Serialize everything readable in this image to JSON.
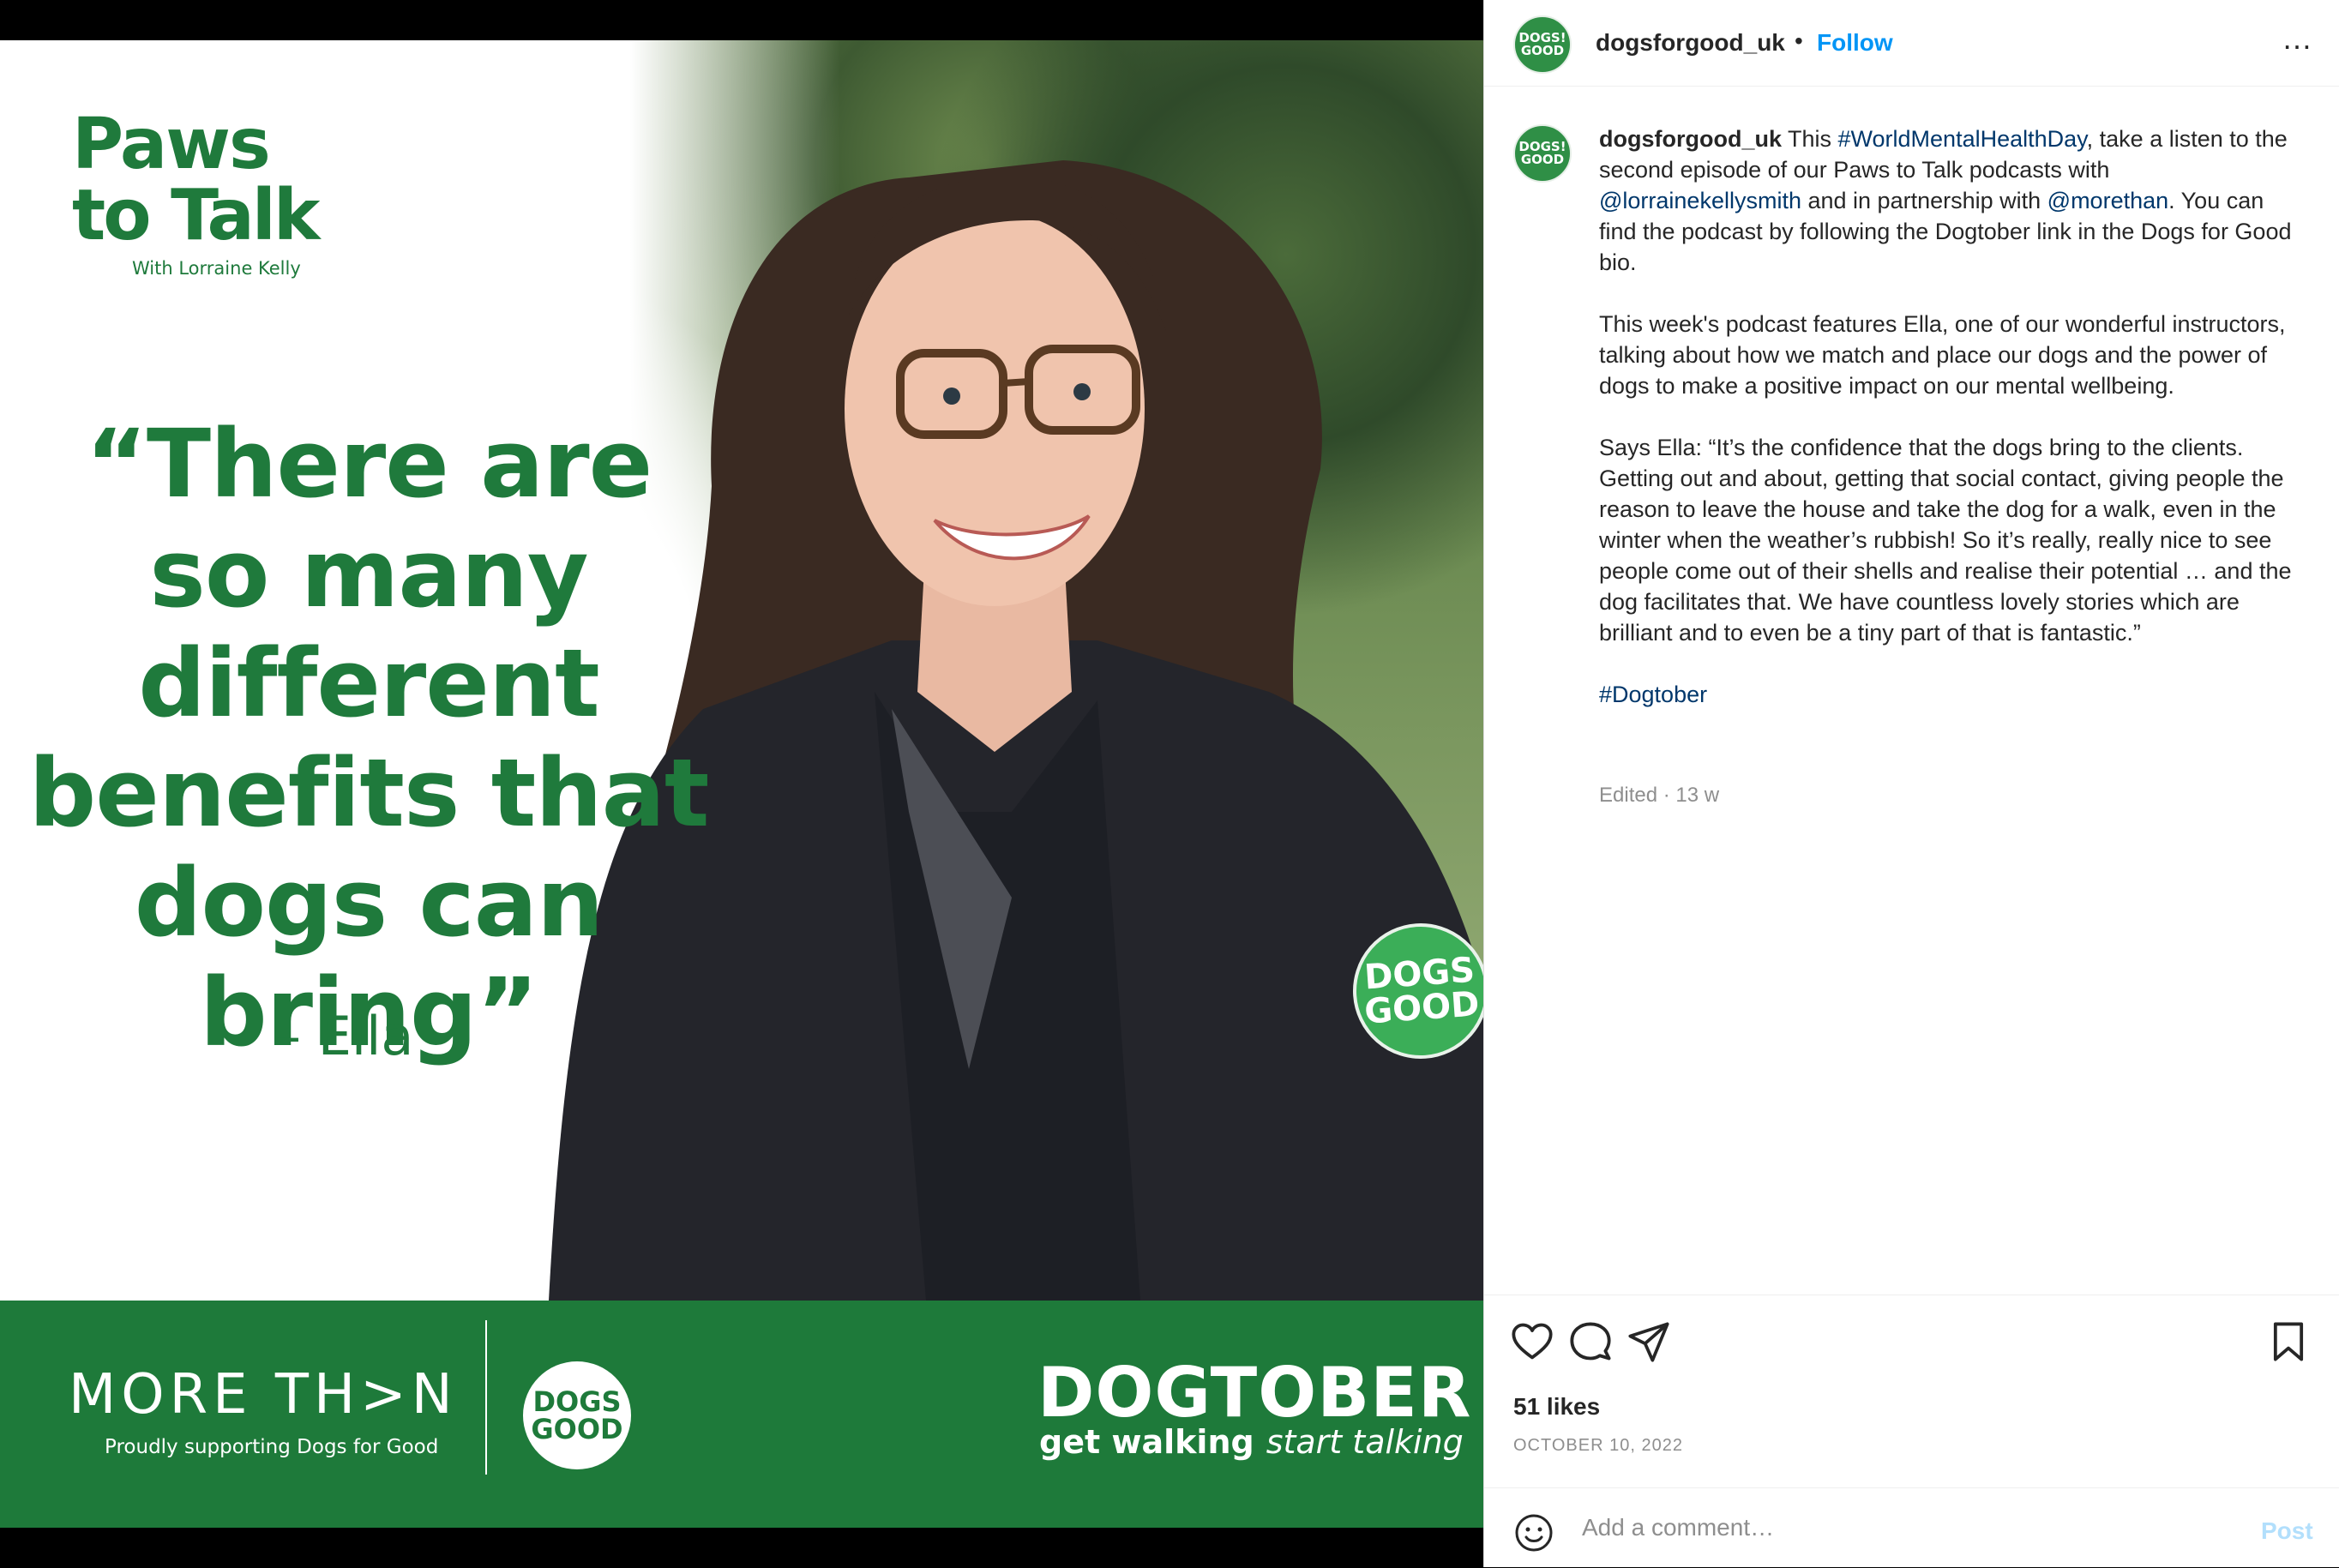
{
  "media": {
    "paws_logo": {
      "line1": "Paws",
      "line2": "to Talk",
      "line3": "With Lorraine Kelly"
    },
    "quote": "“There are so many different benefits that dogs can bring”",
    "quote_author": "– Ella",
    "badge": {
      "line1": "DOGS",
      "line2": "GOOD"
    },
    "banner": {
      "morethan": "MORE TH>N",
      "morethan_sub": "Proudly supporting Dogs for Good",
      "logo_line1": "DOGS",
      "logo_line2": "GOOD",
      "dogtober": "DOGTOBER",
      "dogtober_sub1": "get walking",
      "dogtober_sub2": "start talking"
    }
  },
  "header": {
    "avatar": {
      "line1": "DOGS!",
      "line2": "GOOD"
    },
    "username": "dogsforgood_uk",
    "dot": "•",
    "follow_label": "Follow",
    "more_label": "…"
  },
  "caption": {
    "username": "dogsforgood_uk",
    "p1_a": " This ",
    "p1_tag": "#WorldMentalHealthDay",
    "p1_b": ", take a listen to the second episode of our Paws to Talk podcasts with ",
    "p1_mention1": "@lorrainekellysmith",
    "p1_c": " and in partnership with ",
    "p1_mention2": "@morethan",
    "p1_d": ". You can find the podcast by following the Dogtober link in the Dogs for Good bio.",
    "p2": "This week's podcast features Ella, one of our wonderful instructors, talking about how we match and place our dogs and the power of dogs to make a positive impact on our mental wellbeing.",
    "p3": "Says Ella: “It’s the confidence that the dogs bring to the clients. Getting out and about, getting that social contact, giving people the reason to leave the house and take the dog for a walk, even in the winter when the weather’s rubbish! So it’s really, really nice to see people come out of their shells and realise their potential … and the dog facilitates that. We have countless lovely stories which are brilliant and to even be a tiny part of that is fantastic.”",
    "hashtag": "#Dogtober",
    "meta": "Edited · 13 w"
  },
  "actions": {
    "likes": "51 likes",
    "date": "OCTOBER 10, 2022"
  },
  "comment": {
    "placeholder": "Add a comment…",
    "post_label": "Post"
  },
  "colors": {
    "brand_green": "#1e7a3a",
    "link_blue": "#0095f6",
    "hashtag_blue": "#00376b"
  }
}
